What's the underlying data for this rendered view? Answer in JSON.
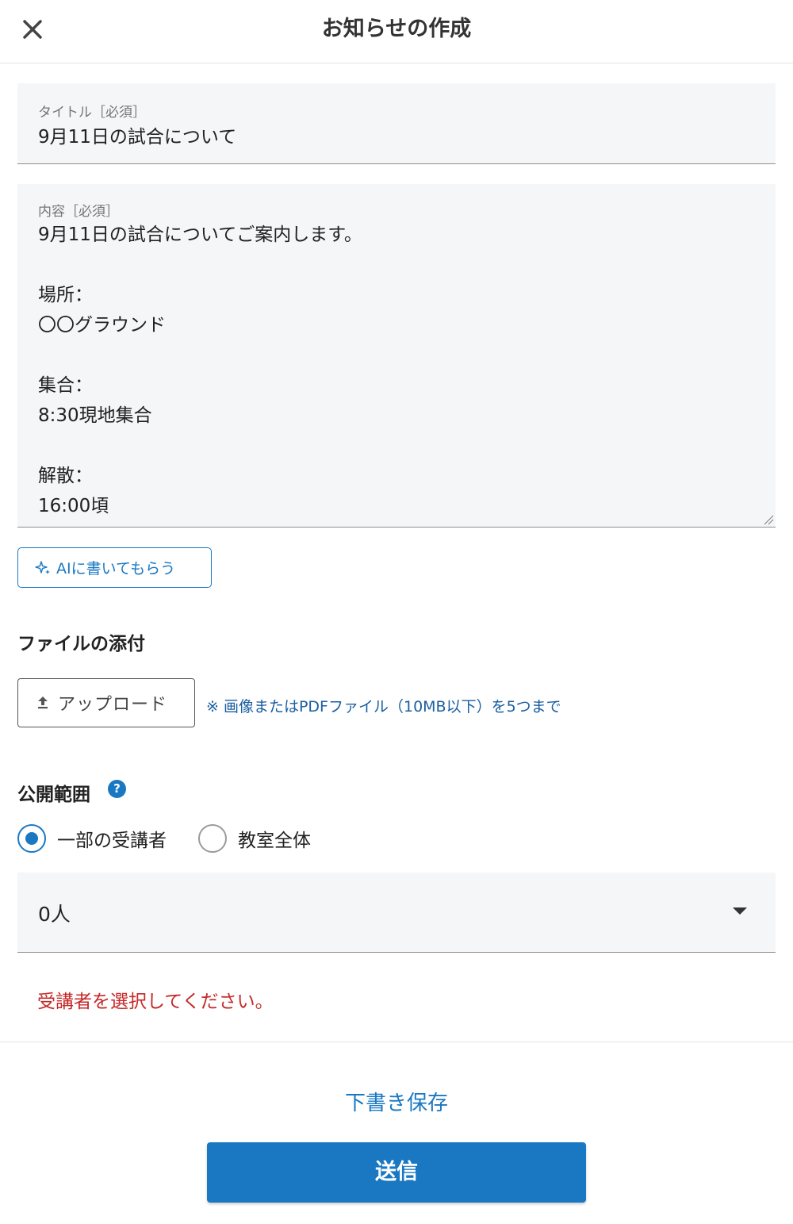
{
  "header": {
    "title": "お知らせの作成",
    "close_icon": "close-icon"
  },
  "title_field": {
    "label": "タイトル［必須］",
    "value": "9月11日の試合について"
  },
  "content_field": {
    "label": "内容［必須］",
    "lines": [
      "9月11日の試合についてご案内します。",
      "",
      "場所：",
      "〇〇グラウンド",
      "",
      "集合：",
      "8:30現地集合",
      "",
      "解散：",
      "16:00頃"
    ]
  },
  "ai_button": {
    "label": "AIに書いてもらう",
    "icon": "sparkle-icon"
  },
  "attachment": {
    "section_title": "ファイルの添付",
    "upload_label": "アップロード",
    "upload_icon": "upload-icon",
    "note": "※ 画像またはPDFファイル（10MB以下）を5つまで"
  },
  "visibility": {
    "section_title": "公開範囲",
    "help_label": "?",
    "options": [
      {
        "label": "一部の受講者",
        "checked": true
      },
      {
        "label": "教室全体",
        "checked": false
      }
    ],
    "select_value": "0人",
    "error": "受講者を選択してください。"
  },
  "footer": {
    "draft_label": "下書き保存",
    "submit_label": "送信"
  },
  "colors": {
    "accent": "#1a78c2",
    "error": "#c62828",
    "field_bg": "#f5f6f8"
  }
}
